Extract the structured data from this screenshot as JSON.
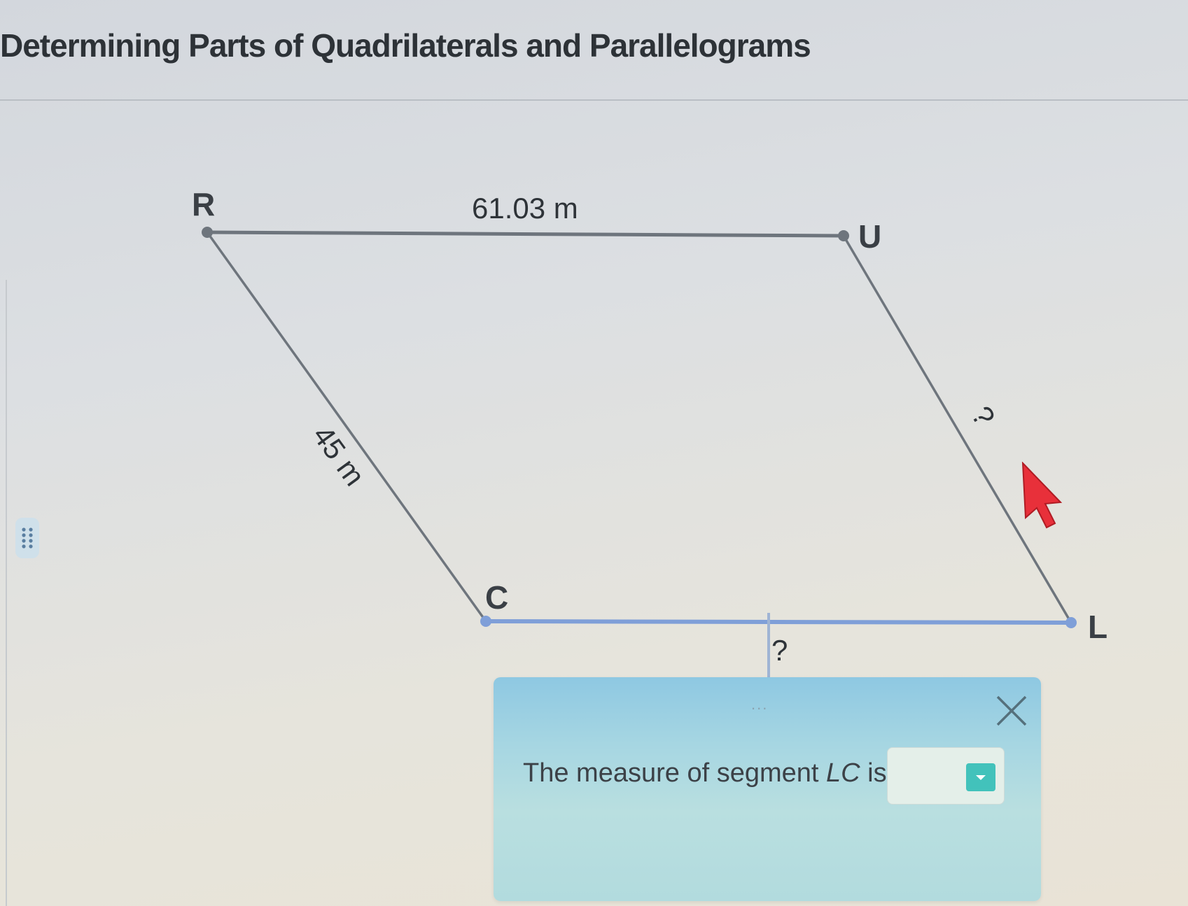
{
  "page": {
    "title": "Determining Parts of Quadrilaterals and Parallelograms"
  },
  "diagram": {
    "vertices": {
      "R": "R",
      "U": "U",
      "C": "C",
      "L": "L"
    },
    "labels": {
      "RU": "61.03 m",
      "RC": "45 m",
      "UL": "?",
      "CL": "?"
    }
  },
  "dialog": {
    "grip": "...",
    "prompt": {
      "before": "The measure of segment ",
      "segment": "LC",
      "after": " is:"
    },
    "answer": {
      "selected": ""
    },
    "colors": {
      "top": "#8ec8e2",
      "bottom": "#b2dbde",
      "dropdown_arrow": "#42c2bb"
    }
  },
  "colors": {
    "cursor": "#e8303a",
    "highlight_segment": "#7f9fd8",
    "edges": "#6d747c"
  }
}
